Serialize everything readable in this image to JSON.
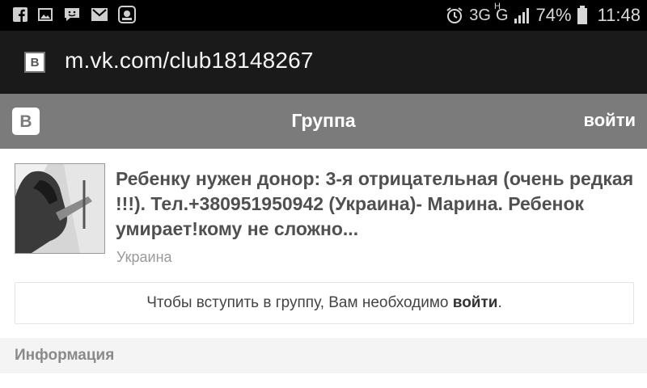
{
  "status_bar": {
    "left_icons": [
      "facebook-icon",
      "gallery-icon",
      "chat-icon",
      "mail-icon",
      "vk-notification-icon"
    ],
    "network": "3G",
    "network_secondary": "G",
    "network_secondary_badge": "H",
    "battery": "74%",
    "time": "11:48"
  },
  "browser": {
    "url": "m.vk.com/club18148267",
    "favicon_letter": "B"
  },
  "vk_header": {
    "logo_letter": "B",
    "title": "Группа",
    "login_label": "войти"
  },
  "group": {
    "name": "Ребенку нужен донор: 3-я отрицательная (очень редкая !!!). Тел.+380951950942 (Украина)- Марина. Ребенок умирает!кому не сложно...",
    "location": "Украина"
  },
  "join_notice": {
    "text": "Чтобы вступить в группу, Вам необходимо ",
    "link": "войти",
    "suffix": "."
  },
  "info_section": {
    "title": "Информация"
  },
  "colors": {
    "status_bar_bg": "#000000",
    "address_bar_bg": "#1a1a1a",
    "vk_header_bg": "#7b7b7b",
    "info_bg": "#f4f4f4"
  }
}
